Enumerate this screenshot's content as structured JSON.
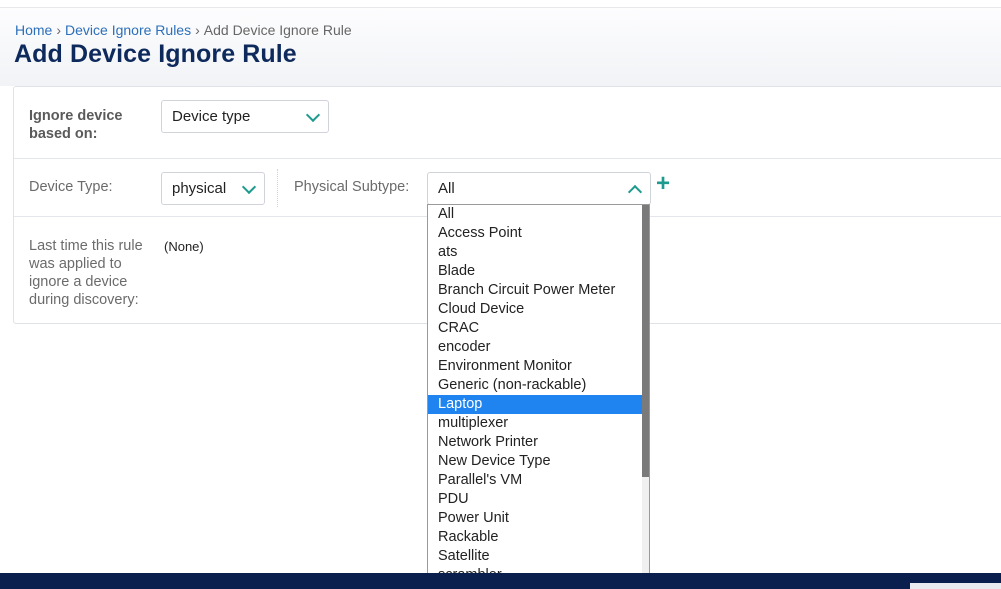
{
  "breadcrumb": {
    "home": "Home",
    "sep1": "›",
    "rules": "Device Ignore Rules",
    "sep2": "›",
    "current": "Add Device Ignore Rule"
  },
  "page_title": "Add Device Ignore Rule",
  "form": {
    "ignore_label": "Ignore device based on:",
    "ignore_value": "Device type",
    "device_type_label": "Device Type:",
    "device_type_value": "physical",
    "subtype_label": "Physical Subtype:",
    "subtype_value": "All",
    "add_symbol": "+",
    "last_applied_label": "Last time this rule was applied to ignore a device during discovery:",
    "last_applied_value": "(None)"
  },
  "dropdown": {
    "selected": "Laptop",
    "options": [
      "All",
      "Access Point",
      "ats",
      "Blade",
      "Branch Circuit Power Meter",
      "Cloud Device",
      "CRAC",
      "encoder",
      "Environment Monitor",
      "Generic (non-rackable)",
      "Laptop",
      "multiplexer",
      "Network Printer",
      "New Device Type",
      "Parallel's VM",
      "PDU",
      "Power Unit",
      "Rackable",
      "Satellite",
      "scrambler"
    ]
  },
  "colors": {
    "title": "#0e2a5c",
    "link": "#2c6fba",
    "accent": "#1e9a8f",
    "highlight": "#1f84f0",
    "footer": "#0b1f4f"
  }
}
